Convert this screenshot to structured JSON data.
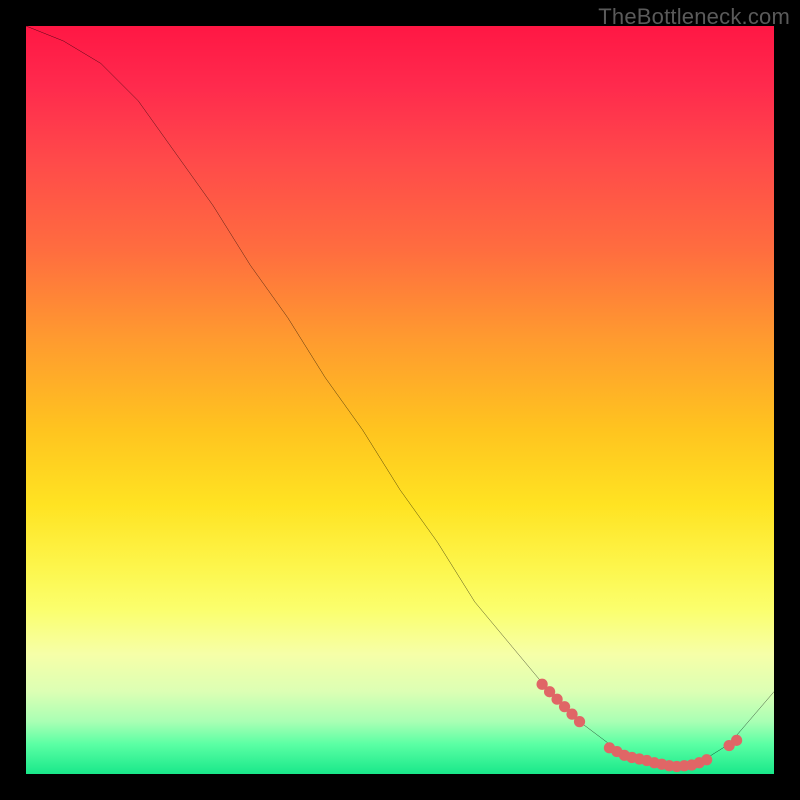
{
  "watermark": "TheBottleneck.com",
  "chart_data": {
    "type": "line",
    "title": "",
    "xlabel": "",
    "ylabel": "",
    "xlim": [
      0,
      100
    ],
    "ylim": [
      0,
      100
    ],
    "grid": false,
    "legend": false,
    "series": [
      {
        "name": "bottleneck-curve",
        "color": "#000000",
        "x": [
          0,
          5,
          10,
          15,
          20,
          25,
          30,
          35,
          40,
          45,
          50,
          55,
          60,
          65,
          70,
          74,
          78,
          82,
          86,
          90,
          94,
          100
        ],
        "y": [
          100,
          98,
          95,
          90,
          83,
          76,
          68,
          61,
          53,
          46,
          38,
          31,
          23,
          17,
          11,
          7,
          4,
          2,
          1,
          1.5,
          4,
          11
        ]
      }
    ],
    "markers": [
      {
        "name": "highlight-descent",
        "color": "#e06666",
        "points": [
          {
            "x": 69,
            "y": 12.0
          },
          {
            "x": 70,
            "y": 11.0
          },
          {
            "x": 71,
            "y": 10.0
          },
          {
            "x": 72,
            "y": 9.0
          },
          {
            "x": 73,
            "y": 8.0
          },
          {
            "x": 74,
            "y": 7.0
          }
        ]
      },
      {
        "name": "highlight-valley",
        "color": "#e06666",
        "points": [
          {
            "x": 78,
            "y": 3.5
          },
          {
            "x": 79,
            "y": 3.0
          },
          {
            "x": 80,
            "y": 2.5
          },
          {
            "x": 81,
            "y": 2.2
          },
          {
            "x": 82,
            "y": 2.0
          },
          {
            "x": 83,
            "y": 1.8
          },
          {
            "x": 84,
            "y": 1.5
          },
          {
            "x": 85,
            "y": 1.3
          },
          {
            "x": 86,
            "y": 1.1
          },
          {
            "x": 87,
            "y": 1.0
          },
          {
            "x": 88,
            "y": 1.1
          },
          {
            "x": 89,
            "y": 1.2
          },
          {
            "x": 90,
            "y": 1.5
          },
          {
            "x": 91,
            "y": 1.9
          }
        ]
      },
      {
        "name": "highlight-rise",
        "color": "#e06666",
        "points": [
          {
            "x": 94,
            "y": 3.8
          },
          {
            "x": 95,
            "y": 4.5
          }
        ]
      }
    ],
    "background_gradient": {
      "orientation": "vertical",
      "stops": [
        {
          "pos": 0.0,
          "color": "#ff1744"
        },
        {
          "pos": 0.5,
          "color": "#ffc41f"
        },
        {
          "pos": 0.8,
          "color": "#fbff6d"
        },
        {
          "pos": 1.0,
          "color": "#19e88a"
        }
      ]
    }
  }
}
